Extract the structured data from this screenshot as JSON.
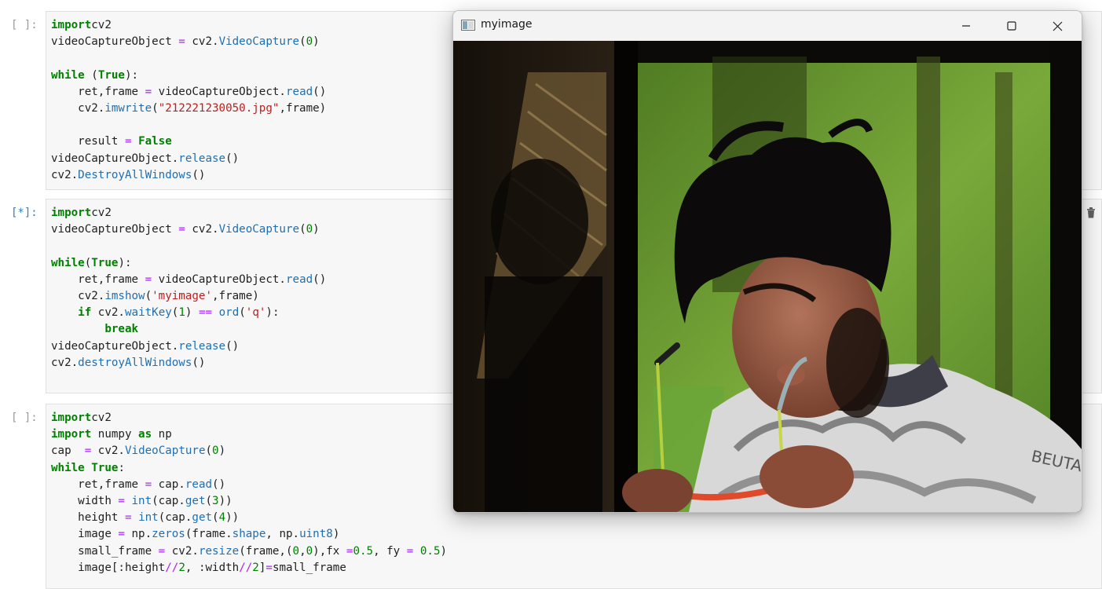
{
  "cells": [
    {
      "prompt": "[ ]:",
      "state": "idle",
      "code": [
        [
          [
            "kw",
            "import"
          ],
          [
            "",
            "cv2"
          ]
        ],
        [
          [
            "",
            "videoCaptureObject "
          ],
          [
            "op",
            "="
          ],
          [
            "",
            " cv2."
          ],
          [
            "fn",
            "VideoCapture"
          ],
          [
            "",
            "("
          ],
          [
            "num",
            "0"
          ],
          [
            "",
            ")"
          ]
        ],
        [],
        [
          [
            "kw",
            "while"
          ],
          [
            "",
            " ("
          ],
          [
            "kw",
            "True"
          ],
          [
            "",
            "):"
          ]
        ],
        [
          [
            "",
            "    ret,frame "
          ],
          [
            "op",
            "="
          ],
          [
            "",
            " videoCaptureObject."
          ],
          [
            "fn",
            "read"
          ],
          [
            "",
            "()"
          ]
        ],
        [
          [
            "",
            "    cv2."
          ],
          [
            "fn",
            "imwrite"
          ],
          [
            "",
            "("
          ],
          [
            "str",
            "\"212221230050.jpg\""
          ],
          [
            "",
            ",frame)"
          ]
        ],
        [],
        [
          [
            "",
            "    result "
          ],
          [
            "op",
            "="
          ],
          [
            "",
            " "
          ],
          [
            "kw",
            "False"
          ]
        ],
        [
          [
            "",
            "videoCaptureObject."
          ],
          [
            "fn",
            "release"
          ],
          [
            "",
            "()"
          ]
        ],
        [
          [
            "",
            "cv2."
          ],
          [
            "fn",
            "DestroyAllWindows"
          ],
          [
            "",
            "()"
          ]
        ]
      ]
    },
    {
      "prompt": "[*]:",
      "state": "running",
      "code": [
        [
          [
            "kw",
            "import"
          ],
          [
            "",
            "cv2"
          ]
        ],
        [
          [
            "",
            "videoCaptureObject "
          ],
          [
            "op",
            "="
          ],
          [
            "",
            " cv2."
          ],
          [
            "fn",
            "VideoCapture"
          ],
          [
            "",
            "("
          ],
          [
            "num",
            "0"
          ],
          [
            "",
            ")"
          ]
        ],
        [],
        [
          [
            "kw",
            "while"
          ],
          [
            "",
            "("
          ],
          [
            "kw",
            "True"
          ],
          [
            "",
            "):"
          ]
        ],
        [
          [
            "",
            "    ret,frame "
          ],
          [
            "op",
            "="
          ],
          [
            "",
            " videoCaptureObject."
          ],
          [
            "fn",
            "read"
          ],
          [
            "",
            "()"
          ]
        ],
        [
          [
            "",
            "    cv2."
          ],
          [
            "fn",
            "imshow"
          ],
          [
            "",
            "("
          ],
          [
            "str",
            "'myimage'"
          ],
          [
            "",
            ",frame)"
          ]
        ],
        [
          [
            "",
            "    "
          ],
          [
            "kw",
            "if"
          ],
          [
            "",
            " cv2."
          ],
          [
            "fn",
            "waitKey"
          ],
          [
            "",
            "("
          ],
          [
            "num",
            "1"
          ],
          [
            "",
            ") "
          ],
          [
            "op",
            "=="
          ],
          [
            "",
            " "
          ],
          [
            "fn",
            "ord"
          ],
          [
            "",
            "("
          ],
          [
            "str",
            "'q'"
          ],
          [
            "",
            "):"
          ]
        ],
        [
          [
            "",
            "        "
          ],
          [
            "kw",
            "break"
          ]
        ],
        [
          [
            "",
            "videoCaptureObject."
          ],
          [
            "fn",
            "release"
          ],
          [
            "",
            "()"
          ]
        ],
        [
          [
            "",
            "cv2."
          ],
          [
            "fn",
            "destroyAllWindows"
          ],
          [
            "",
            "()"
          ]
        ]
      ]
    },
    {
      "prompt": "[ ]:",
      "state": "idle",
      "code": [
        [
          [
            "kw",
            "import"
          ],
          [
            "",
            "cv2"
          ]
        ],
        [
          [
            "kw",
            "import"
          ],
          [
            "",
            " numpy "
          ],
          [
            "kw",
            "as"
          ],
          [
            "",
            " np"
          ]
        ],
        [
          [
            "",
            "cap  "
          ],
          [
            "op",
            "="
          ],
          [
            "",
            " cv2."
          ],
          [
            "fn",
            "VideoCapture"
          ],
          [
            "",
            "("
          ],
          [
            "num",
            "0"
          ],
          [
            "",
            ")"
          ]
        ],
        [
          [
            "kw",
            "while"
          ],
          [
            "",
            " "
          ],
          [
            "kw",
            "True"
          ],
          [
            "",
            ":"
          ]
        ],
        [
          [
            "",
            "    ret,frame "
          ],
          [
            "op",
            "="
          ],
          [
            "",
            " cap."
          ],
          [
            "fn",
            "read"
          ],
          [
            "",
            "()"
          ]
        ],
        [
          [
            "",
            "    width "
          ],
          [
            "op",
            "="
          ],
          [
            "",
            " "
          ],
          [
            "fn",
            "int"
          ],
          [
            "",
            "(cap."
          ],
          [
            "fn",
            "get"
          ],
          [
            "",
            "("
          ],
          [
            "num",
            "3"
          ],
          [
            "",
            "))"
          ]
        ],
        [
          [
            "",
            "    height "
          ],
          [
            "op",
            "="
          ],
          [
            "",
            " "
          ],
          [
            "fn",
            "int"
          ],
          [
            "",
            "(cap."
          ],
          [
            "fn",
            "get"
          ],
          [
            "",
            "("
          ],
          [
            "num",
            "4"
          ],
          [
            "",
            "))"
          ]
        ],
        [
          [
            "",
            "    image "
          ],
          [
            "op",
            "="
          ],
          [
            "",
            " np."
          ],
          [
            "fn",
            "zeros"
          ],
          [
            "",
            "(frame."
          ],
          [
            "fn",
            "shape"
          ],
          [
            "",
            ", np."
          ],
          [
            "fn",
            "uint8"
          ],
          [
            "",
            ")"
          ]
        ],
        [
          [
            "",
            "    small_frame "
          ],
          [
            "op",
            "="
          ],
          [
            "",
            " cv2."
          ],
          [
            "fn",
            "resize"
          ],
          [
            "",
            "(frame,("
          ],
          [
            "num",
            "0"
          ],
          [
            "",
            ","
          ],
          [
            "num",
            "0"
          ],
          [
            "",
            "),fx "
          ],
          [
            "op",
            "="
          ],
          [
            "num",
            "0.5"
          ],
          [
            "",
            ", fy "
          ],
          [
            "op",
            "="
          ],
          [
            "",
            " "
          ],
          [
            "num",
            "0.5"
          ],
          [
            "",
            ")"
          ]
        ],
        [
          [
            "",
            "    image[:height"
          ],
          [
            "op",
            "//"
          ],
          [
            "num",
            "2"
          ],
          [
            "",
            ", :width"
          ],
          [
            "op",
            "//"
          ],
          [
            "num",
            "2"
          ],
          [
            "",
            "]"
          ],
          [
            "op",
            "="
          ],
          [
            "",
            "small_frame"
          ]
        ]
      ]
    }
  ],
  "window": {
    "title": "myimage",
    "icon": "opencv-window-icon",
    "buttons": [
      "minimize-icon",
      "maximize-icon",
      "close-icon"
    ]
  },
  "colors": {
    "keyword": "#008000",
    "operator": "#aa22ff",
    "function": "#1f6fb2",
    "string": "#ba2121",
    "number": "#008000",
    "running_prompt": "#307fc1"
  }
}
